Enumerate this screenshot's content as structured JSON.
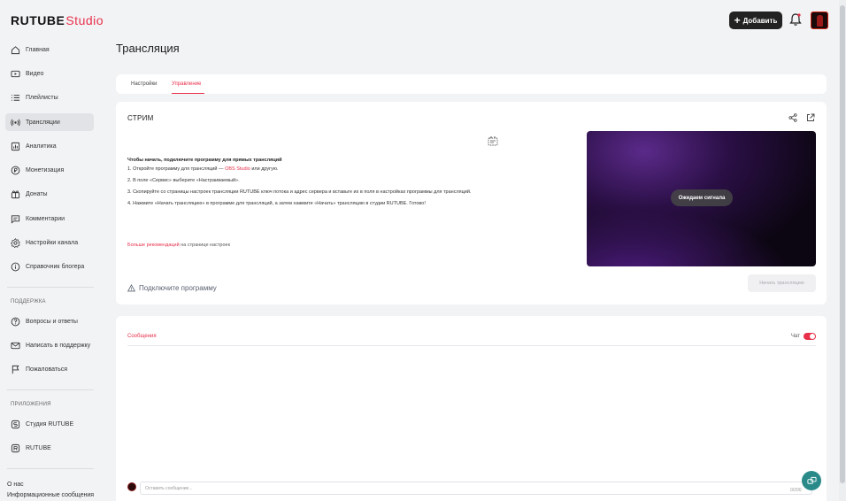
{
  "header": {
    "logo_main": "RUTUBE",
    "logo_studio": "Studio",
    "add_label": "Добавить"
  },
  "sidebar": {
    "items": [
      {
        "label": "Главная",
        "icon": "home-icon"
      },
      {
        "label": "Видео",
        "icon": "video-icon"
      },
      {
        "label": "Плейлисты",
        "icon": "playlist-icon"
      },
      {
        "label": "Трансляции",
        "icon": "broadcast-icon",
        "active": true
      },
      {
        "label": "Аналитика",
        "icon": "analytics-icon"
      },
      {
        "label": "Монетизация",
        "icon": "coin-icon"
      },
      {
        "label": "Донаты",
        "icon": "gift-icon"
      },
      {
        "label": "Комментарии",
        "icon": "comment-icon"
      },
      {
        "label": "Настройки канала",
        "icon": "gear-icon"
      },
      {
        "label": "Справочник блогера",
        "icon": "info-icon"
      }
    ],
    "support_heading": "ПОДДЕРЖКА",
    "support_items": [
      {
        "label": "Вопросы и ответы",
        "icon": "question-icon"
      },
      {
        "label": "Написать в поддержку",
        "icon": "mail-icon"
      },
      {
        "label": "Пожаловаться",
        "icon": "flag-icon"
      }
    ],
    "apps_heading": "ПРИЛОЖЕНИЯ",
    "apps_items": [
      {
        "label": "Студия RUTUBE",
        "icon": "studio-app-icon"
      },
      {
        "label": "RUTUBE",
        "icon": "rutube-app-icon"
      }
    ],
    "footer": [
      "О нас",
      "Информационные сообщения"
    ]
  },
  "main": {
    "title": "Трансляция",
    "tabs": [
      {
        "label": "Настройки",
        "active": false
      },
      {
        "label": "Управление",
        "active": true
      }
    ],
    "stream": {
      "title": "СТРИМ",
      "instructions_head": "Чтобы начать, подключите программу для прямых трансляций",
      "step1_a": "1. Откройте программу для трансляций — ",
      "step1_link": "OBS Studio",
      "step1_b": " или другую.",
      "step2": "2. В поле «Сервис» выберите «Настраиваемый».",
      "step3": "3. Скопируйте со страницы настроек трансляции RUTUBE ключ потока и адрес сервера и вставьте их в поля в настройках программы для трансляций.",
      "step4": "4. Нажмите «Начать трансляцию» в программе для трансляций, а затем нажмите «Начать» трансляцию в студии RUTUBE. Готово!",
      "more_link": "Больше рекомендаций",
      "more_rest": " на странице настроек",
      "connect_label": "Подключите программу",
      "waiting_label": "Ожидаем сигнала",
      "start_label": "Начать трансляцию"
    },
    "chat": {
      "label": "Сообщения",
      "toggle_label": "Чат",
      "toggle_on": true,
      "input_placeholder": "Оставить сообщение...",
      "counter": "0/200"
    }
  },
  "colors": {
    "accent": "#e8304a",
    "dark": "#222222",
    "fab": "#2a8a8a"
  }
}
